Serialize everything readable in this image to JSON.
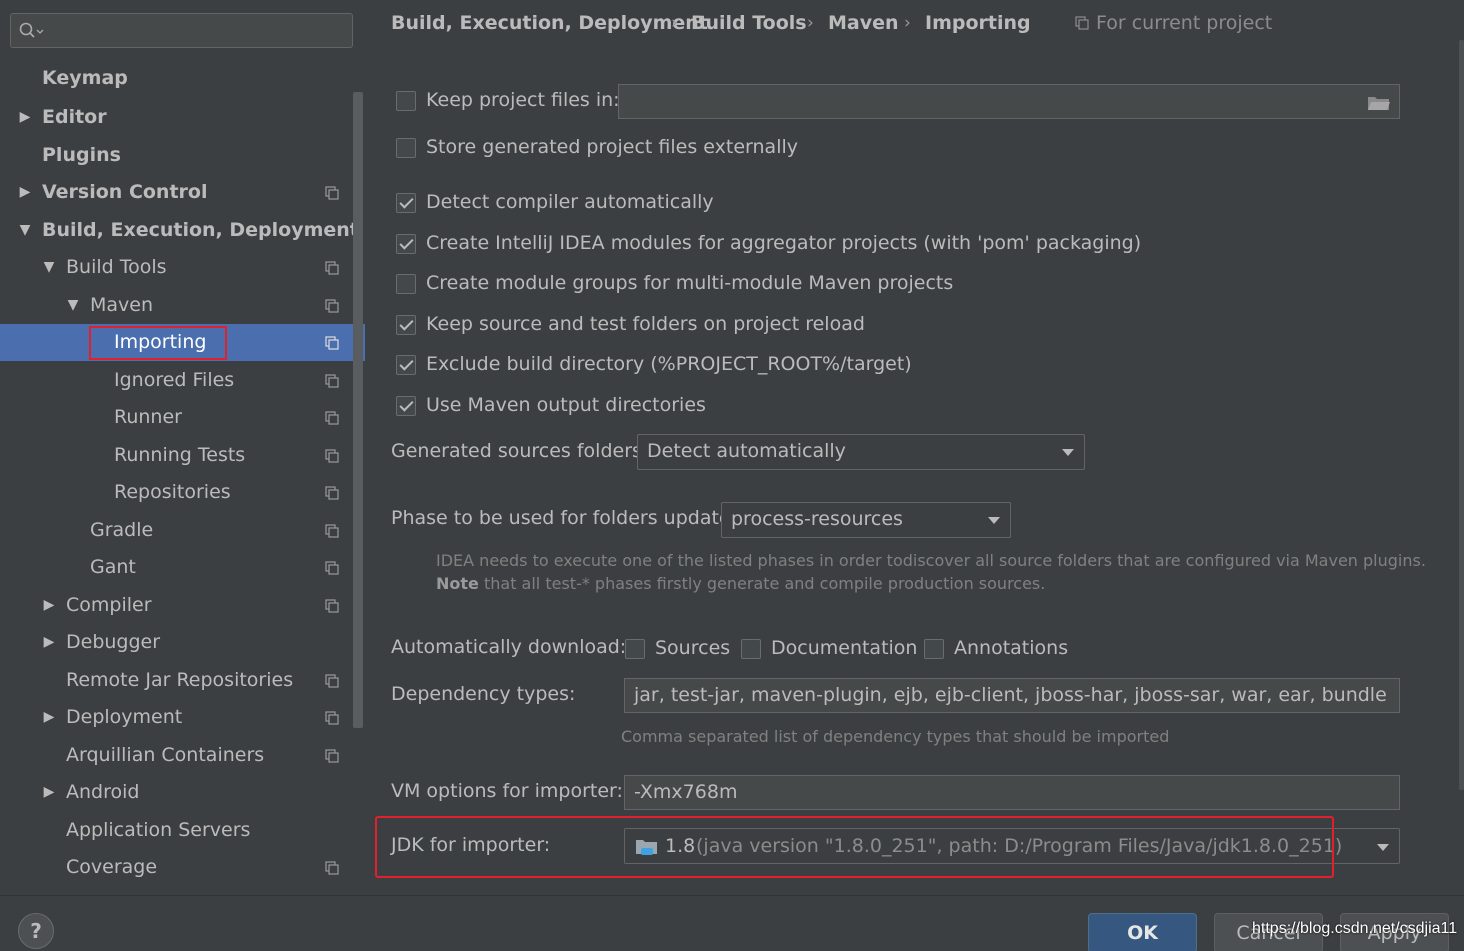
{
  "sidebar": {
    "search_placeholder": "",
    "items": [
      {
        "label": "Keymap"
      },
      {
        "label": "Editor"
      },
      {
        "label": "Plugins"
      },
      {
        "label": "Version Control"
      },
      {
        "label": "Build, Execution, Deployment"
      },
      {
        "label": "Build Tools"
      },
      {
        "label": "Maven"
      },
      {
        "label": "Importing"
      },
      {
        "label": "Ignored Files"
      },
      {
        "label": "Runner"
      },
      {
        "label": "Running Tests"
      },
      {
        "label": "Repositories"
      },
      {
        "label": "Gradle"
      },
      {
        "label": "Gant"
      },
      {
        "label": "Compiler"
      },
      {
        "label": "Debugger"
      },
      {
        "label": "Remote Jar Repositories"
      },
      {
        "label": "Deployment"
      },
      {
        "label": "Arquillian Containers"
      },
      {
        "label": "Android"
      },
      {
        "label": "Application Servers"
      },
      {
        "label": "Coverage"
      }
    ]
  },
  "breadcrumb": {
    "items": [
      "Build, Execution, Deployment",
      "Build Tools",
      "Maven",
      "Importing"
    ],
    "separator": "›",
    "scope_label": "For current project"
  },
  "settings": {
    "keep_project_files": {
      "label": "Keep project files in:",
      "checked": false,
      "value": ""
    },
    "store_externally": {
      "label": "Store generated project files externally",
      "checked": false
    },
    "detect_compiler": {
      "label": "Detect compiler automatically",
      "checked": true
    },
    "create_modules": {
      "label": "Create IntelliJ IDEA modules for aggregator projects (with 'pom' packaging)",
      "checked": true
    },
    "create_groups": {
      "label": "Create module groups for multi-module Maven projects",
      "checked": false
    },
    "keep_source_folders": {
      "label": "Keep source and test folders on project reload",
      "checked": true
    },
    "exclude_build_dir": {
      "label": "Exclude build directory (%PROJECT_ROOT%/target)",
      "checked": true
    },
    "use_output_dirs": {
      "label": "Use Maven output directories",
      "checked": true
    },
    "generated_sources": {
      "label": "Generated sources folders:",
      "value": "Detect automatically"
    },
    "phase": {
      "label": "Phase to be used for folders update:",
      "value": "process-resources"
    },
    "phase_hint_line1": "IDEA needs to execute one of the listed phases in order todiscover all source folders that are configured via Maven plugins.",
    "phase_hint_note": "Note",
    "phase_hint_line2": " that all test-* phases firstly generate and compile production sources.",
    "auto_download": {
      "label": "Automatically download:",
      "sources": {
        "label": "Sources",
        "checked": false
      },
      "documentation": {
        "label": "Documentation",
        "checked": false
      },
      "annotations": {
        "label": "Annotations",
        "checked": false
      }
    },
    "dependency_types": {
      "label": "Dependency types:",
      "value": "jar, test-jar, maven-plugin, ejb, ejb-client, jboss-har, jboss-sar, war, ear, bundle",
      "hint": "Comma separated list of dependency types that should be imported"
    },
    "vm_options": {
      "label": "VM options for importer:",
      "value": "-Xmx768m"
    },
    "jdk": {
      "label": "JDK for importer:",
      "version": "1.8",
      "detail": "(java version \"1.8.0_251\", path: D:/Program Files/Java/jdk1.8.0_251)"
    }
  },
  "footer": {
    "help": "?",
    "ok": "OK",
    "cancel": "Cancel",
    "apply": "Apply",
    "watermark": "https://blog.csdn.net/csdjia11"
  },
  "colors": {
    "background": "#3c3f41",
    "selection": "#4b6eaf",
    "highlight_border": "#e0202a",
    "ok_button": "#365880"
  }
}
